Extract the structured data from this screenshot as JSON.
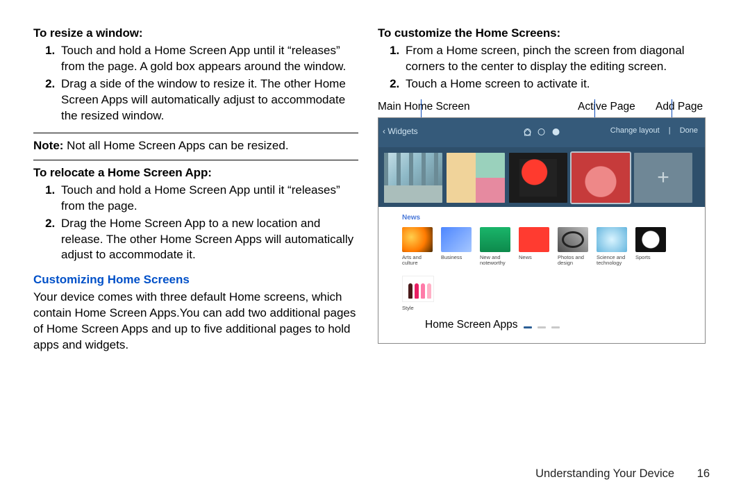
{
  "left": {
    "resize_heading": "To resize a window:",
    "resize_steps": [
      "Touch and hold a Home Screen App until it “releases” from the page. A gold box appears around the window.",
      "Drag a side of the window to resize it. The other Home Screen Apps will automatically adjust to accommodate the resized window."
    ],
    "note_label": "Note:",
    "note_text": " Not all Home Screen Apps can be resized.",
    "relocate_heading": "To relocate a Home Screen App:",
    "relocate_steps": [
      "Touch and hold a Home Screen App until it “releases” from the page.",
      "Drag the Home Screen App to a new location and release. The other Home Screen Apps will automatically adjust to accommodate it."
    ],
    "section_blue": "Customizing Home Screens",
    "section_body": "Your device comes with three default Home screens, which contain Home Screen Apps.You can add two additional pages of Home Screen Apps and up to five additional pages to hold apps and widgets."
  },
  "right": {
    "customize_heading": "To customize the Home Screens:",
    "customize_steps": [
      "From a Home screen, pinch the screen from diagonal corners to the center to display the editing screen.",
      "Touch a Home screen to activate it."
    ],
    "labels": {
      "main": "Main Home Screen",
      "active": "Active Page",
      "add": "Add Page",
      "hsa": "Home Screen Apps"
    },
    "figure": {
      "bar_back": "‹ Widgets",
      "bar_change": "Change layout",
      "bar_done": "Done",
      "news_head": "News",
      "categories": [
        "Arts and culture",
        "Business",
        "New and noteworthy",
        "News",
        "Photos and design",
        "Science and technology",
        "Sports"
      ],
      "style_label": "Style"
    }
  },
  "footer": {
    "chapter": "Understanding Your Device",
    "page": "16"
  }
}
